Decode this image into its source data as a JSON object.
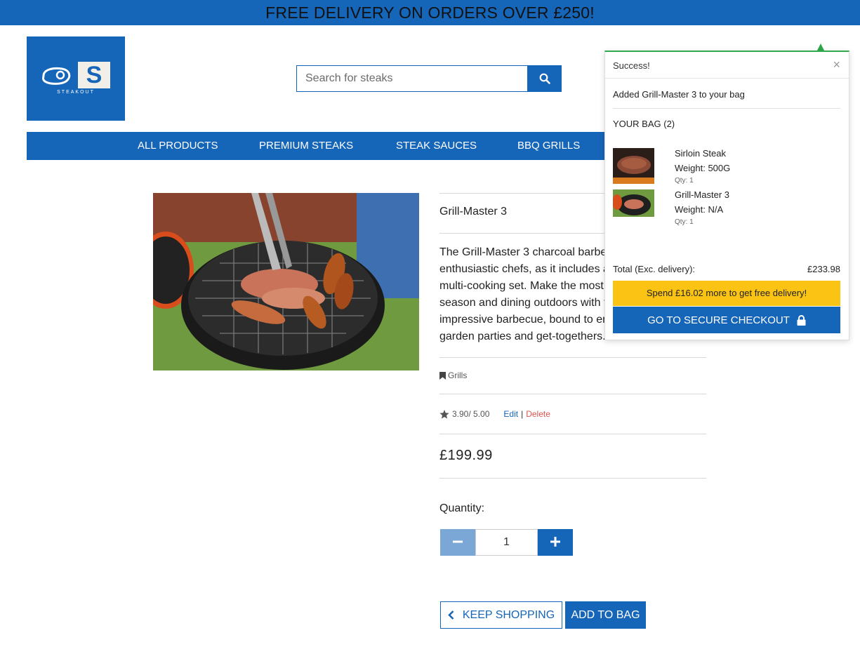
{
  "banner": {
    "text": "FREE DELIVERY ON ORDERS OVER £250!"
  },
  "logo": {
    "letter": "S",
    "text": "STEAKOUT"
  },
  "search": {
    "placeholder": "Search for steaks"
  },
  "nav": {
    "items": [
      "ALL PRODUCTS",
      "PREMIUM STEAKS",
      "STEAK SAUCES",
      "BBQ GRILLS"
    ]
  },
  "product": {
    "title": "Grill-Master 3",
    "description_lines": [
      "The Grill-Master 3 charcoal barbe",
      "enthusiastic chefs, as it includes a",
      "multi-cooking set. Make the most",
      "season and dining outdoors with t",
      "impressive barbecue, bound to en",
      "garden parties and get-togethers."
    ],
    "category": "Grills",
    "rating": "3.90/ 5.00",
    "edit_label": "Edit",
    "separator": "|",
    "delete_label": "Delete",
    "price": "£199.99",
    "quantity_label": "Quantity:",
    "quantity_value": "1",
    "keep_shopping_label": "KEEP SHOPPING",
    "add_to_bag_label": "ADD TO BAG"
  },
  "toast": {
    "title": "Success!",
    "close": "×",
    "message": "Added Grill-Master 3 to your bag",
    "bag_count": "YOUR BAG (2)",
    "items": [
      {
        "name": "Sirloin Steak",
        "weight": "Weight: 500G",
        "qty": "Qty: 1"
      },
      {
        "name": "Grill-Master 3",
        "weight": "Weight: N/A",
        "qty": "Qty: 1"
      }
    ],
    "total_label": "Total (Exc. delivery):",
    "total_value": "£233.98",
    "free_delivery_text": "Spend £16.02 more to get free delivery!",
    "checkout_label": "GO TO SECURE CHECKOUT"
  },
  "colors": {
    "brand_blue": "#1565b8",
    "success_green": "#2ea84a",
    "warning_yellow": "#fbc414",
    "delete_red": "#d9534f"
  },
  "icons": {
    "search": "search-icon",
    "category": "bookmark-icon",
    "rating": "star-icon",
    "minus": "minus-icon",
    "plus": "plus-icon",
    "back": "chevron-left-icon",
    "lock": "lock-icon",
    "close": "close-icon"
  }
}
